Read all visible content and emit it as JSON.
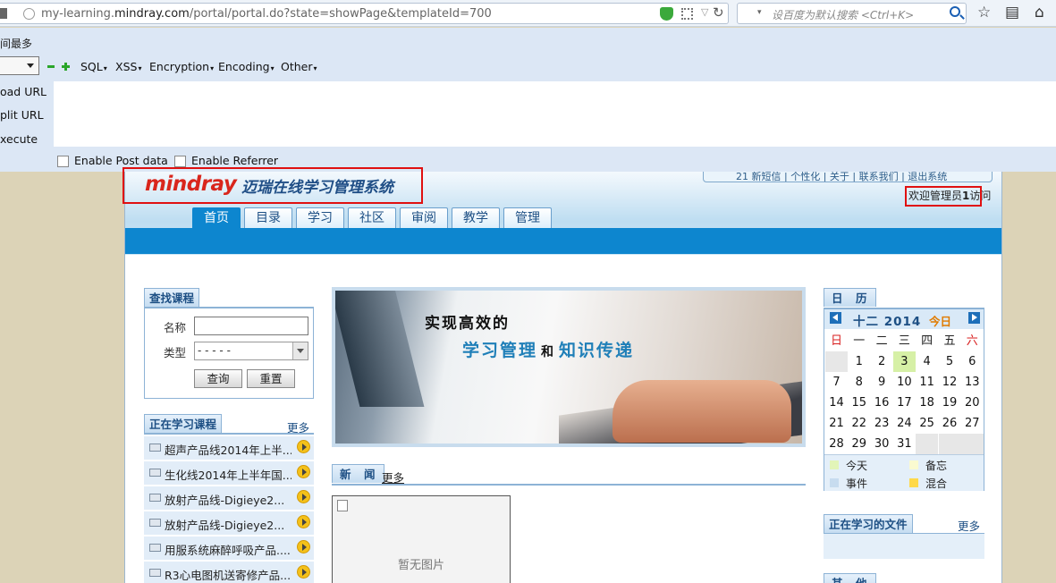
{
  "browser": {
    "url_prefix": "my-learning.",
    "url_domain": "mindray.com",
    "url_suffix": "/portal/portal.do?state=showPage&templateId=700",
    "search_placeholder": "设百度为默认搜索 <Ctrl+K>",
    "toolbar_icons": [
      "star-icon",
      "reading-list-icon",
      "home-icon"
    ]
  },
  "hackbar": {
    "cut_label": "间最多",
    "menus": [
      "SQL",
      "XSS",
      "Encryption",
      "Encoding",
      "Other"
    ],
    "side_buttons": [
      "oad URL",
      "plit URL",
      "xecute"
    ],
    "enable_post": "Enable Post data",
    "enable_referrer": "Enable Referrer"
  },
  "header": {
    "logo": "mindray",
    "system_name": "迈瑞在线学习管理系统",
    "top_links": "21   新短信 | 个性化 | 关于 | 联系我们 | 退出系统",
    "welcome_prefix": "欢迎管理员",
    "welcome_user": "1",
    "welcome_suffix": "访问"
  },
  "nav": {
    "tabs": [
      "首页",
      "目录",
      "学习",
      "社区",
      "审阅",
      "教学",
      "管理"
    ],
    "active": 0
  },
  "find_course": {
    "title": "查找课程",
    "name_label": "名称",
    "type_label": "类型",
    "type_value": "- - - - -",
    "search_button": "查询",
    "reset_button": "重置"
  },
  "learning_courses": {
    "title": "正在学习课程",
    "more": "更多",
    "items": [
      "超声产品线2014年上半...",
      "生化线2014年上半年国...",
      "放射产品线-Digieye2...",
      "放射产品线-Digieye2...",
      "用服系统麻醉呼吸产品....",
      "R3心电图机送寄修产品..."
    ]
  },
  "banner": {
    "line1": "实现高效的",
    "line2a": "学习管理",
    "line2_and": "和",
    "line2b": "知识传递"
  },
  "news": {
    "title": "新　闻",
    "more": "更多",
    "no_image": "暂无图片"
  },
  "calendar": {
    "title": "日　历",
    "month": "十二  2014",
    "today_label": "今日",
    "weekdays": [
      "日",
      "一",
      "二",
      "三",
      "四",
      "五",
      "六"
    ],
    "weeks": [
      [
        "",
        "1",
        "2",
        "3",
        "4",
        "5",
        "6"
      ],
      [
        "7",
        "8",
        "9",
        "10",
        "11",
        "12",
        "13"
      ],
      [
        "14",
        "15",
        "16",
        "17",
        "18",
        "19",
        "20"
      ],
      [
        "21",
        "22",
        "23",
        "24",
        "25",
        "26",
        "27"
      ],
      [
        "28",
        "29",
        "30",
        "31",
        "",
        "",
        ""
      ]
    ],
    "today": "3",
    "legend": [
      {
        "label": "今天",
        "color": "#e2f5b8"
      },
      {
        "label": "备忘",
        "color": "#fafad0"
      },
      {
        "label": "事件",
        "color": "#c7dcef"
      },
      {
        "label": "混合",
        "color": "#ffd94a"
      }
    ]
  },
  "files": {
    "title": "正在学习的文件",
    "more": "更多"
  },
  "bottom_panel": {
    "title": "其　他"
  }
}
